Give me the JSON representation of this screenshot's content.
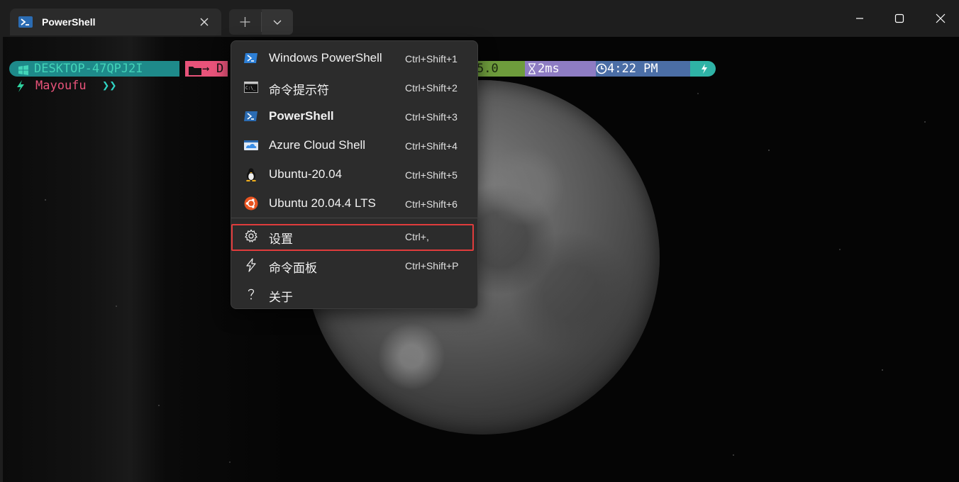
{
  "window": {
    "tab_title": "PowerShell",
    "tab_icon": "powershell-icon",
    "new_tab_icon": "plus-icon",
    "dropdown_icon": "chevron-down-icon",
    "controls": [
      "minimize-icon",
      "maximize-icon",
      "close-icon"
    ]
  },
  "terminal": {
    "host": "DESKTOP-47QPJ2I",
    "path_fragment": "D",
    "version_fragment": "5.0",
    "duration": "2ms",
    "time": "4:22 PM",
    "user": "Mayoufu",
    "prompt_symbol": "❯❯",
    "colors": {
      "host_seg": "#1e8a8a",
      "path_seg": "#e8537a",
      "version_seg": "#6e9c3c",
      "duration_seg": "#8e7cc3",
      "time_seg": "#4b6ea6",
      "end_seg": "#2fb3a6"
    }
  },
  "menu": {
    "profiles": [
      {
        "label": "Windows PowerShell",
        "shortcut": "Ctrl+Shift+1",
        "icon": "windows-powershell-icon"
      },
      {
        "label": "命令提示符",
        "shortcut": "Ctrl+Shift+2",
        "icon": "command-prompt-icon"
      },
      {
        "label": "PowerShell",
        "shortcut": "Ctrl+Shift+3",
        "icon": "powershell-icon"
      },
      {
        "label": "Azure Cloud Shell",
        "shortcut": "Ctrl+Shift+4",
        "icon": "azure-cloud-shell-icon"
      },
      {
        "label": "Ubuntu-20.04",
        "shortcut": "Ctrl+Shift+5",
        "icon": "linux-penguin-icon"
      },
      {
        "label": "Ubuntu 20.04.4 LTS",
        "shortcut": "Ctrl+Shift+6",
        "icon": "ubuntu-icon"
      }
    ],
    "actions": [
      {
        "label": "设置",
        "shortcut": "Ctrl+,",
        "icon": "gear-icon"
      },
      {
        "label": "命令面板",
        "shortcut": "Ctrl+Shift+P",
        "icon": "lightning-icon"
      },
      {
        "label": "关于",
        "shortcut": "",
        "icon": "question-icon"
      }
    ],
    "highlight_color": "#e03c3c"
  }
}
